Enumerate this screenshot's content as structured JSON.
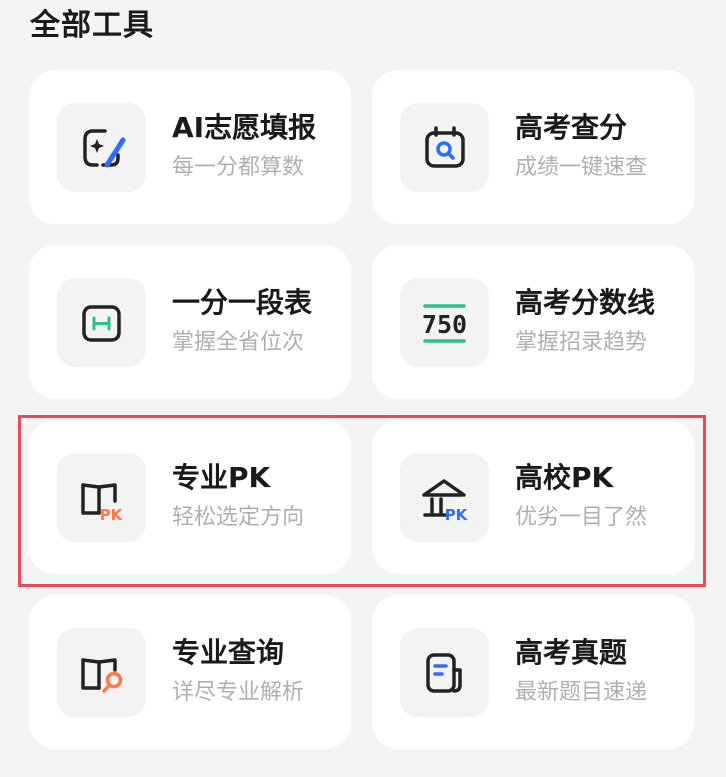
{
  "section": {
    "title": "全部工具"
  },
  "tools": [
    {
      "title": "AI志愿填报",
      "subtitle": "每一分都算数",
      "icon": "ai-pen-icon"
    },
    {
      "title": "高考查分",
      "subtitle": "成绩一键速查",
      "icon": "calendar-search-icon"
    },
    {
      "title": "一分一段表",
      "subtitle": "掌握全省位次",
      "icon": "score-range-icon"
    },
    {
      "title": "高考分数线",
      "subtitle": "掌握招录趋势",
      "icon": "score-line-750-icon",
      "icon_text": "750"
    },
    {
      "title": "专业PK",
      "subtitle": "轻松选定方向",
      "icon": "book-pk-icon",
      "icon_text": "PK"
    },
    {
      "title": "高校PK",
      "subtitle": "优劣一目了然",
      "icon": "university-pk-icon",
      "icon_text": "PK"
    },
    {
      "title": "专业查询",
      "subtitle": "详尽专业解析",
      "icon": "book-search-icon"
    },
    {
      "title": "高考真题",
      "subtitle": "最新题目速递",
      "icon": "exam-paper-icon"
    }
  ],
  "colors": {
    "accent_blue": "#2f6bff",
    "accent_green": "#2ec08a",
    "accent_orange": "#ff7a45",
    "highlight_red": "#e84a57",
    "icon_dark": "#222222"
  }
}
